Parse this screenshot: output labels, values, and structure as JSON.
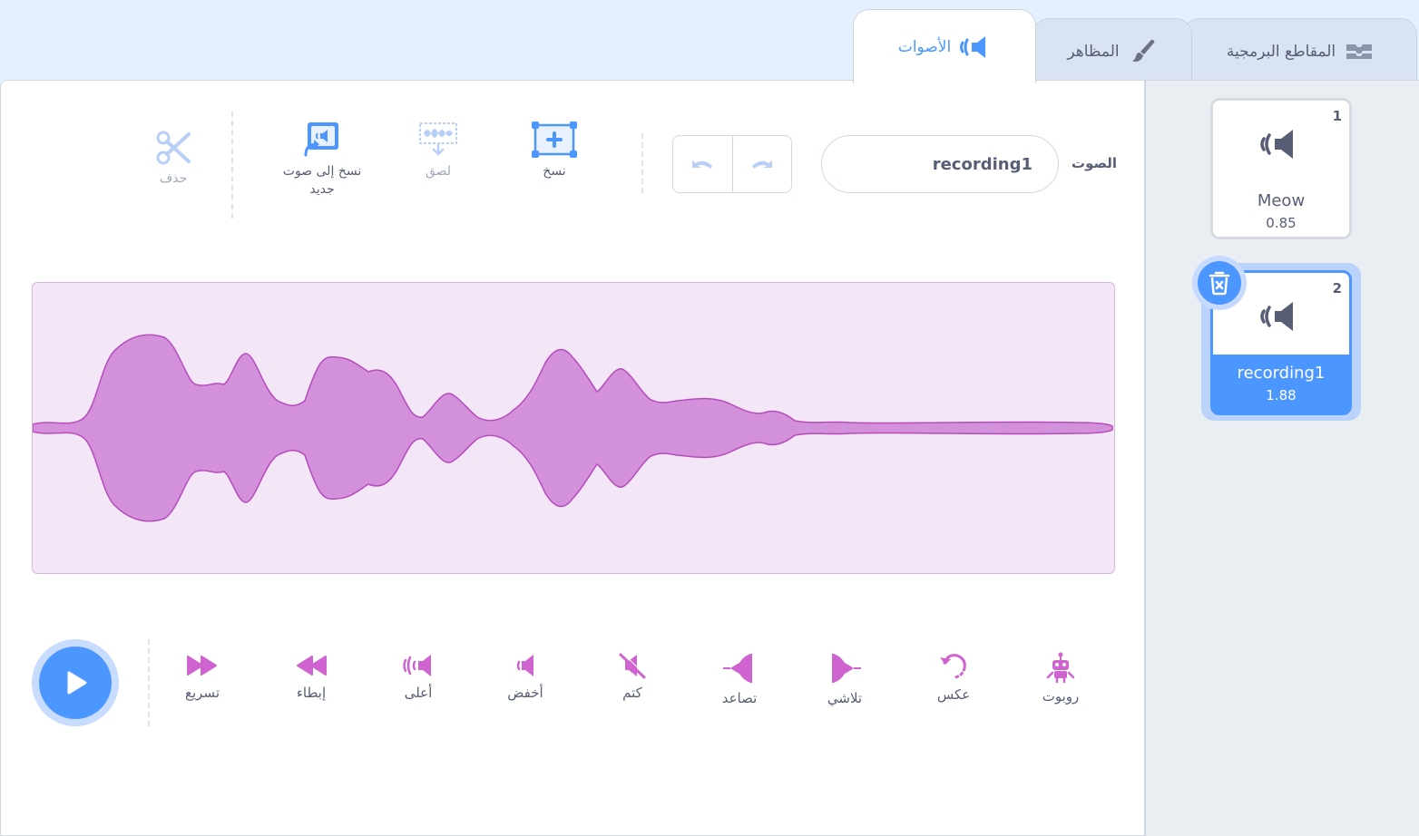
{
  "tabs": [
    {
      "label": "المقاطع البرمجية",
      "icon": "code-icon"
    },
    {
      "label": "المظاهر",
      "icon": "brush-icon"
    },
    {
      "label": "الأصوات",
      "icon": "sound-icon",
      "active": true
    }
  ],
  "toolbar": {
    "name_label": "الصوت",
    "name_value": "recording1",
    "copy_label": "نسخ",
    "paste_label": "لصق",
    "copy_new_label": "نسخ إلى صوت جديد",
    "delete_label": "حذف"
  },
  "effects": {
    "faster": "تسريع",
    "slower": "إبطاء",
    "louder": "أعلى",
    "softer": "أخفض",
    "mute": "كتم",
    "fade_in": "تصاعد",
    "fade_out": "تلاشي",
    "reverse": "عكس",
    "robot": "روبوت"
  },
  "sounds": [
    {
      "number": "1",
      "name": "Meow",
      "duration": "0.85"
    },
    {
      "number": "2",
      "name": "recording1",
      "duration": "1.88",
      "selected": true
    }
  ],
  "colors": {
    "accent": "#4c97ff",
    "effect": "#cf63cf",
    "wave_fill": "#d391dc",
    "wave_bg": "#f3e6f7"
  }
}
